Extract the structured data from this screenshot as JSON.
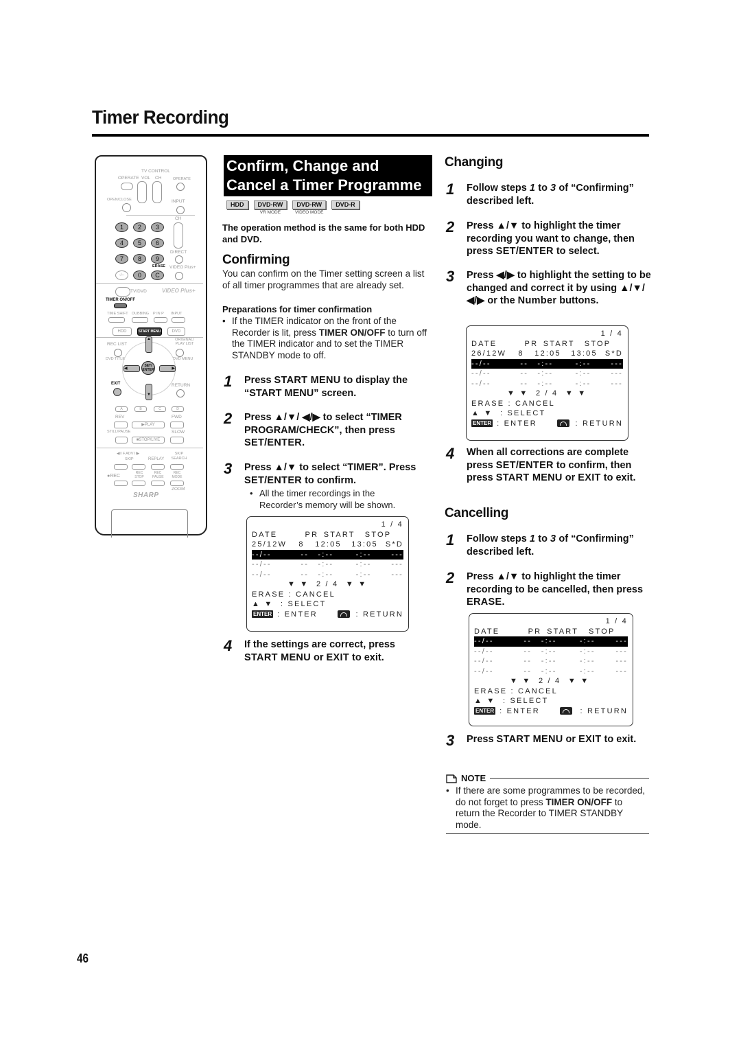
{
  "page": {
    "title": "Timer Recording",
    "page_number": "46"
  },
  "remote": {
    "labels": {
      "operate": "OPERATE",
      "tv_control": "TV CONTROL",
      "vol": "VOL",
      "ch": "CH",
      "tv_operate": "OPERATE",
      "open_close": "OPEN/CLOSE",
      "input": "INPUT",
      "ch2": "CH",
      "direct": "DIRECT",
      "erase": "ERASE",
      "video_plus": "VIDEO Plus+",
      "tv_dvd": "TV/DVD",
      "video_plus_logo": "VIDEO Plus+",
      "timer_onoff": "TIMER ON/OFF",
      "time_shift": "TIME SHIFT",
      "dubbing": "DUBBING",
      "pinp": "P IN P",
      "input2": "INPUT",
      "hdd": "HDD",
      "start_menu": "START MENU",
      "dvd": "DVD",
      "rec_list": "REC LIST",
      "original_play_list": "ORIGINAL/ PLAY LIST",
      "dvd_title": "DVD TITLE",
      "dvd_menu": "DVD MENU",
      "set_enter": "SET/ ENTER",
      "exit": "EXIT",
      "return": "RETURN",
      "a": "A",
      "b": "B",
      "c": "C",
      "d": "D",
      "rev": "REV",
      "fwd": "FWD",
      "play": "▶PLAY",
      "still_pause": "STILL/PAUSE",
      "slow": "SLOW",
      "stop_live": "■STOP/LIVE",
      "fadv": "◀II F.ADV II▶",
      "skip": "SKIP",
      "replay": "REPLAY",
      "skip_search": "SKIP SEARCH",
      "rec": "●REC",
      "rec_stop": "REC STOP",
      "rec_pause": "REC PAUSE",
      "rec_mode": "REC MODE",
      "zoom": "ZOOM",
      "brand": "SHARP"
    },
    "number_keys": [
      "1",
      "2",
      "3",
      "4",
      "5",
      "6",
      "7",
      "8",
      "9",
      "-/--",
      "0",
      "C"
    ]
  },
  "middle": {
    "banner_line1": "Confirm, Change and",
    "banner_line2": "Cancel a Timer Programme",
    "badges": [
      {
        "label": "HDD",
        "sub": ""
      },
      {
        "label": "DVD-RW",
        "sub": "VR MODE"
      },
      {
        "label": "DVD-RW",
        "sub": "VIDEO MODE"
      },
      {
        "label": "DVD-R",
        "sub": ""
      }
    ],
    "operation_note": "The operation method is the same for both HDD and DVD.",
    "confirming": {
      "heading": "Confirming",
      "intro": "You can confirm on the Timer setting screen a list of all timer programmes that are already set.",
      "prep_heading": "Preparations for timer confirmation",
      "prep_bullet_a": "If the TIMER indicator on the front of the Recorder is lit, press ",
      "prep_bullet_kw": "TIMER ON/OFF",
      "prep_bullet_b": " to turn off the TIMER indicator and to set the TIMER STANDBY mode to off.",
      "steps": [
        {
          "n": "1",
          "a": "Press ",
          "kw1": "START MENU",
          "b": " to display the “START MENU” screen."
        },
        {
          "n": "2",
          "a": "Press ▲/▼/ ◀/▶ to select “TIMER PROGRAM/CHECK”, then press ",
          "kw1": "SET/ENTER",
          "b": "."
        },
        {
          "n": "3",
          "a": "Press ▲/▼  to select “TIMER”. Press ",
          "kw1": "SET/ENTER",
          "b": " to confirm."
        },
        {
          "n": "4",
          "a": "If the settings are correct, press ",
          "kw1": "START MENU",
          "b": " or ",
          "kw2": "EXIT",
          "c": " to exit."
        }
      ],
      "step3_bullet": "All the timer recordings in the Recorder’s memory will be shown."
    }
  },
  "right": {
    "changing": {
      "heading": "Changing",
      "steps": [
        {
          "n": "1",
          "a": "Follow steps ",
          "i1": "1",
          "b": " to ",
          "i2": "3",
          "c": " of “Confirming” described left."
        },
        {
          "n": "2",
          "a": "Press ▲/▼  to highlight the timer recording you want to change, then press ",
          "kw1": "SET/ENTER",
          "b": " to select."
        },
        {
          "n": "3",
          "a": "Press ◀/▶ to highlight the setting to be changed and correct it by using ▲/▼/◀/▶ or the ",
          "kw1": "Number",
          "b": " buttons."
        },
        {
          "n": "4",
          "a": "When all corrections are complete press ",
          "kw1": "SET/ENTER",
          "b": " to confirm, then press ",
          "kw2": "START MENU",
          "c": " or ",
          "kw3": "EXIT",
          "d": " to exit."
        }
      ]
    },
    "cancelling": {
      "heading": "Cancelling",
      "steps": [
        {
          "n": "1",
          "a": "Follow steps ",
          "i1": "1",
          "b": " to ",
          "i2": "3",
          "c": " of “Confirming” described left."
        },
        {
          "n": "2",
          "a": "Press ▲/▼  to highlight the timer recording to be cancelled, then press ",
          "kw1": "ERASE",
          "b": "."
        },
        {
          "n": "3",
          "a": "Press ",
          "kw1": "START MENU",
          "b": " or ",
          "kw2": "EXIT",
          "c": " to exit."
        }
      ]
    },
    "note": {
      "heading": "NOTE",
      "text_a": "If there are some programmes to be recorded, do not forget to press ",
      "kw": "TIMER ON/OFF",
      "text_b": " to return the Recorder to TIMER STANDBY mode."
    }
  },
  "osd_screens": {
    "confirm": {
      "page": "1 / 4",
      "header": [
        "DATE",
        "PR",
        "START",
        "STOP",
        ""
      ],
      "rows": [
        {
          "cells": [
            "25/12W",
            "8",
            "12:05",
            "13:05",
            "S*D"
          ],
          "highlight": false
        },
        {
          "cells": [
            "--/--",
            "--",
            "-:--",
            "-:--",
            "---"
          ],
          "highlight": true
        },
        {
          "cells": [
            "--/--",
            "--",
            "-:--",
            "-:--",
            "---"
          ],
          "highlight": false
        },
        {
          "cells": [
            "--/--",
            "--",
            "-:--",
            "-:--",
            "---"
          ],
          "highlight": false
        }
      ],
      "pager": "▼ ▼  2 / 4  ▼ ▼",
      "erase": "ERASE : CANCEL",
      "select": "▲ ▼  : SELECT",
      "enter": ": ENTER",
      "enter_icon": "ENTER",
      "return": ": RETURN"
    },
    "change": {
      "page": "1 / 4",
      "header": [
        "DATE",
        "PR",
        "START",
        "STOP",
        ""
      ],
      "rows": [
        {
          "cells": [
            "26/12W",
            "8",
            "12:05",
            "13:05",
            "S*D"
          ],
          "highlight": false
        },
        {
          "cells": [
            "--/--",
            "--",
            "-:--",
            "-:--",
            "---"
          ],
          "highlight": true
        },
        {
          "cells": [
            "--/--",
            "--",
            "-:--",
            "-:--",
            "---"
          ],
          "highlight": false
        },
        {
          "cells": [
            "--/--",
            "--",
            "-:--",
            "-:--",
            "---"
          ],
          "highlight": false
        }
      ],
      "pager": "▼ ▼  2 / 4  ▼ ▼",
      "erase": "ERASE : CANCEL",
      "select": "▲ ▼  : SELECT",
      "enter": ": ENTER",
      "enter_icon": "ENTER",
      "return": ": RETURN"
    },
    "cancel": {
      "page": "1 / 4",
      "header": [
        "DATE",
        "PR",
        "START",
        "STOP",
        ""
      ],
      "rows": [
        {
          "cells": [
            "--/--",
            "--",
            "-:--",
            "-:--",
            "---"
          ],
          "highlight": true
        },
        {
          "cells": [
            "--/--",
            "--",
            "-:--",
            "-:--",
            "---"
          ],
          "highlight": false
        },
        {
          "cells": [
            "--/--",
            "--",
            "-:--",
            "-:--",
            "---"
          ],
          "highlight": false
        },
        {
          "cells": [
            "--/--",
            "--",
            "-:--",
            "-:--",
            "---"
          ],
          "highlight": false
        }
      ],
      "pager": "▼ ▼  2 / 4  ▼ ▼",
      "erase": "ERASE : CANCEL",
      "select": "▲ ▼  : SELECT",
      "enter": ": ENTER",
      "enter_icon": "ENTER",
      "return": ": RETURN"
    }
  }
}
